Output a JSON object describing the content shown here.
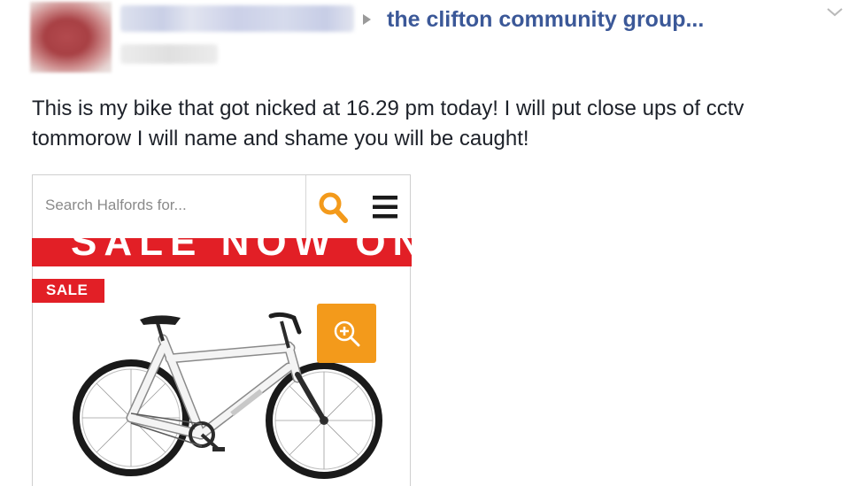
{
  "post": {
    "group_name": "the clifton community group...",
    "text": "This is my bike that got nicked at 16.29 pm today! I will put close ups of cctv tommorow I will name and shame you will be caught!"
  },
  "embedded_screenshot": {
    "search_placeholder": "Search Halfords for...",
    "banner_text": "SALE NOW ON",
    "sale_badge": "SALE",
    "icons": {
      "search": "search-icon",
      "menu": "menu-icon",
      "zoom": "zoom-in-icon",
      "chevron": "chevron-down-icon"
    }
  },
  "colors": {
    "link_blue": "#3b5898",
    "halfords_orange": "#f39a1b",
    "sale_red": "#e21f26"
  }
}
